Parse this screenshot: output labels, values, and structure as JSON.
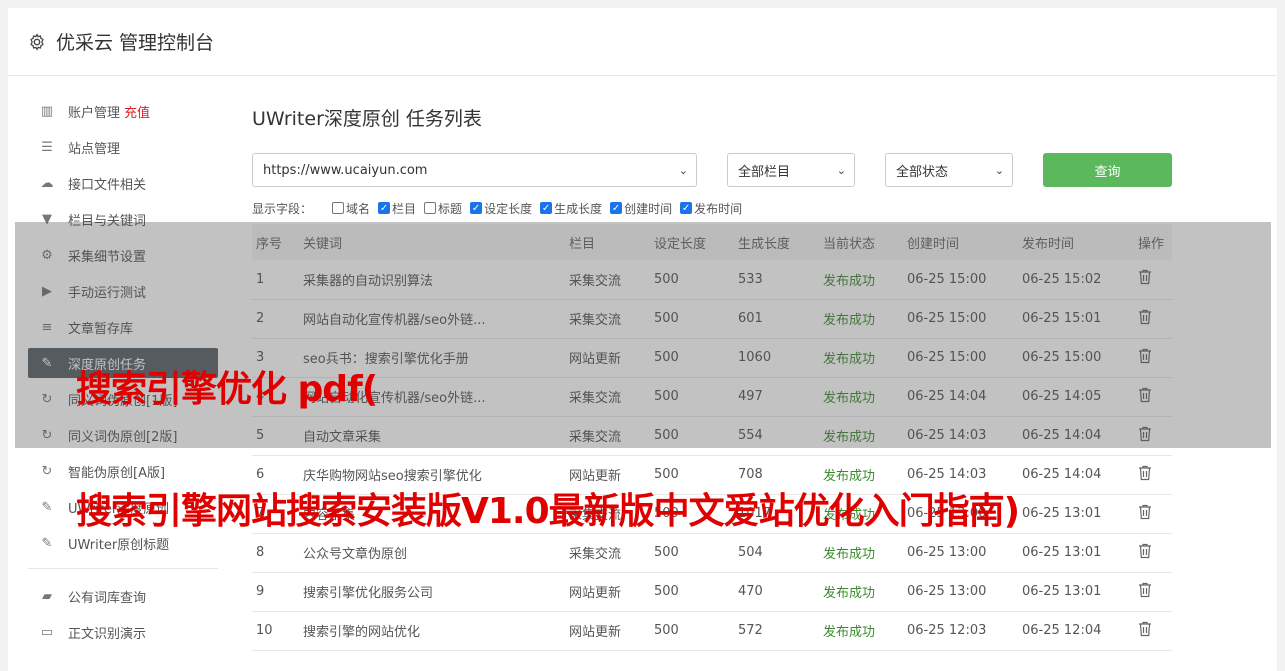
{
  "header": {
    "title": "优采云 管理控制台"
  },
  "sidebar": {
    "items": [
      {
        "name": "sidebar-item-account",
        "icon": "bar-chart-icon",
        "glyph": "▥",
        "label": "账户管理",
        "extra": "充值"
      },
      {
        "name": "sidebar-item-sites",
        "icon": "server-icon",
        "glyph": "☰",
        "label": "站点管理"
      },
      {
        "name": "sidebar-item-api-files",
        "icon": "cloud-upload-icon",
        "glyph": "☁",
        "label": "接口文件相关"
      },
      {
        "name": "sidebar-item-columns-keywords",
        "icon": "filter-icon",
        "glyph": "▼",
        "label": "栏目与关键词"
      },
      {
        "name": "sidebar-item-collect-settings",
        "icon": "gears-icon",
        "glyph": "⚙",
        "label": "采集细节设置"
      },
      {
        "name": "sidebar-item-manual-run",
        "icon": "play-circle-icon",
        "glyph": "▶",
        "label": "手动运行测试"
      },
      {
        "name": "sidebar-item-article-storage",
        "icon": "database-icon",
        "glyph": "≡",
        "label": "文章暂存库"
      },
      {
        "name": "sidebar-item-deep-original",
        "icon": "edit-icon",
        "glyph": "✎",
        "label": "深度原创任务",
        "active": true
      }
    ],
    "items2": [
      {
        "name": "sidebar-item-synonym-v1",
        "icon": "refresh-icon",
        "glyph": "↻",
        "label": "同义词伪原创[1版]"
      },
      {
        "name": "sidebar-item-synonym-v2",
        "icon": "refresh-icon",
        "glyph": "↻",
        "label": "同义词伪原创[2版]"
      },
      {
        "name": "sidebar-item-smart-original",
        "icon": "refresh-icon",
        "glyph": "↻",
        "label": "智能伪原创[A版]"
      },
      {
        "name": "sidebar-item-uwriter-deep",
        "icon": "edit-icon",
        "glyph": "✎",
        "label": "UWriter深度原创"
      },
      {
        "name": "sidebar-item-uwriter-title",
        "icon": "edit-icon",
        "glyph": "✎",
        "label": "UWriter原创标题"
      }
    ],
    "items3": [
      {
        "name": "sidebar-item-public-lexicon",
        "icon": "book-icon",
        "glyph": "▰",
        "label": "公有词库查询"
      },
      {
        "name": "sidebar-item-text-recognition",
        "icon": "monitor-icon",
        "glyph": "▭",
        "label": "正文识别演示"
      }
    ]
  },
  "main": {
    "title": "UWriter深度原创 任务列表",
    "site_select": "https://www.ucaiyun.com",
    "column_select": "全部栏目",
    "status_select": "全部状态",
    "query_label": "查询",
    "fields_label": "显示字段：",
    "fields": [
      {
        "label": "域名",
        "checked": false
      },
      {
        "label": "栏目",
        "checked": true
      },
      {
        "label": "标题",
        "checked": false
      },
      {
        "label": "设定长度",
        "checked": true
      },
      {
        "label": "生成长度",
        "checked": true
      },
      {
        "label": "创建时间",
        "checked": true
      },
      {
        "label": "发布时间",
        "checked": true
      }
    ],
    "columns": [
      "序号",
      "关键词",
      "栏目",
      "设定长度",
      "生成长度",
      "当前状态",
      "创建时间",
      "发布时间",
      "操作"
    ],
    "rows": [
      [
        "1",
        "采集器的自动识别算法",
        "采集交流",
        "500",
        "533",
        "发布成功",
        "06-25 15:00",
        "06-25 15:02"
      ],
      [
        "2",
        "网站自动化宣传机器/seo外链...",
        "采集交流",
        "500",
        "601",
        "发布成功",
        "06-25 15:00",
        "06-25 15:01"
      ],
      [
        "3",
        "seo兵书：搜索引擎优化手册",
        "网站更新",
        "500",
        "1060",
        "发布成功",
        "06-25 15:00",
        "06-25 15:00"
      ],
      [
        "4",
        "网站自动化宣传机器/seo外链...",
        "采集交流",
        "500",
        "497",
        "发布成功",
        "06-25 14:04",
        "06-25 14:05"
      ],
      [
        "5",
        "自动文章采集",
        "采集交流",
        "500",
        "554",
        "发布成功",
        "06-25 14:03",
        "06-25 14:04"
      ],
      [
        "6",
        "庆华购物网站seo搜索引擎优化",
        "网站更新",
        "500",
        "708",
        "发布成功",
        "06-25 14:03",
        "06-25 14:04"
      ],
      [
        "7",
        "内容采集",
        "采集交流",
        "500",
        "1017",
        "发布成功",
        "06-25 13:00",
        "06-25 13:01"
      ],
      [
        "8",
        "公众号文章伪原创",
        "采集交流",
        "500",
        "504",
        "发布成功",
        "06-25 13:00",
        "06-25 13:01"
      ],
      [
        "9",
        "搜索引擎优化服务公司",
        "网站更新",
        "500",
        "470",
        "发布成功",
        "06-25 13:00",
        "06-25 13:01"
      ],
      [
        "10",
        "搜索引擎的网站优化",
        "网站更新",
        "500",
        "572",
        "发布成功",
        "06-25 12:03",
        "06-25 12:04"
      ]
    ]
  },
  "watermark": {
    "line1": "搜索引擎优化 pdf(",
    "line2": "搜索引擎网站搜索安装版V1.0最新版中文爱站优化入门指南)"
  }
}
